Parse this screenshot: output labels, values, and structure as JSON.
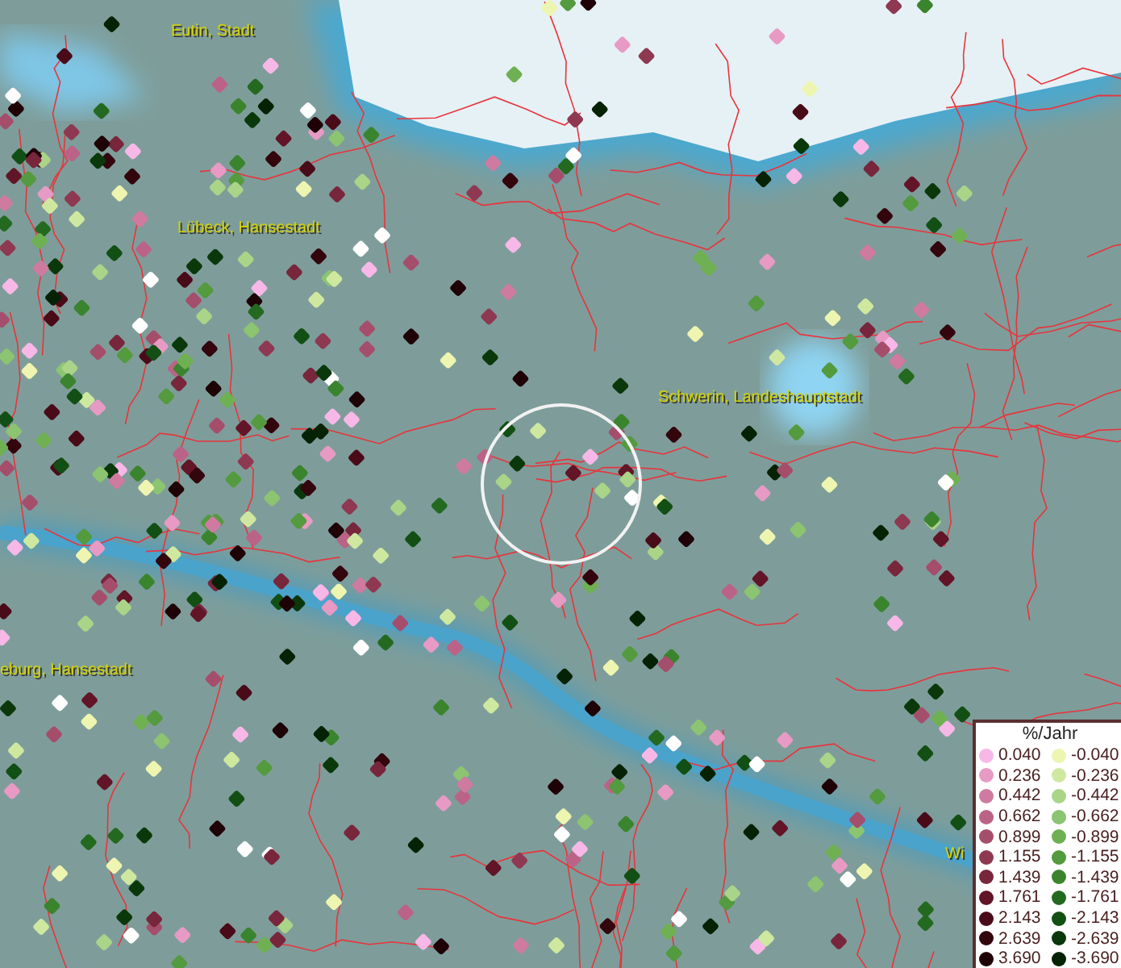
{
  "map": {
    "labels": [
      {
        "text": "Eutin, Stadt"
      },
      {
        "text": "Lübeck, Hansestadt"
      },
      {
        "text": "Schwerin, Landeshauptstadt"
      },
      {
        "text": "eburg, Hansestadt"
      },
      {
        "text": "Wi"
      }
    ]
  },
  "legend": {
    "title": "%/Jahr",
    "items": [
      {
        "label": "0.040",
        "color": "#f7b8e8"
      },
      {
        "label": "-0.040",
        "color": "#eef5b0"
      },
      {
        "label": "0.236",
        "color": "#e79ac4"
      },
      {
        "label": "-0.236",
        "color": "#cfe8a0"
      },
      {
        "label": "0.442",
        "color": "#cf7aa0"
      },
      {
        "label": "-0.442",
        "color": "#aad488"
      },
      {
        "label": "0.662",
        "color": "#bb6386"
      },
      {
        "label": "-0.662",
        "color": "#8cc471"
      },
      {
        "label": "0.899",
        "color": "#a54e6c"
      },
      {
        "label": "-0.899",
        "color": "#6fb052"
      },
      {
        "label": "1.155",
        "color": "#8e3851"
      },
      {
        "label": "-1.155",
        "color": "#549a3e"
      },
      {
        "label": "1.439",
        "color": "#78263c"
      },
      {
        "label": "-1.439",
        "color": "#3b842e"
      },
      {
        "label": "1.761",
        "color": "#621527"
      },
      {
        "label": "-1.761",
        "color": "#246920"
      },
      {
        "label": "2.143",
        "color": "#4a0b18"
      },
      {
        "label": "-2.143",
        "color": "#124f14"
      },
      {
        "label": "2.639",
        "color": "#33050d"
      },
      {
        "label": "-2.639",
        "color": "#0a380b"
      },
      {
        "label": "3.690",
        "color": "#1e0206"
      },
      {
        "label": "-3.690",
        "color": "#052205"
      }
    ]
  }
}
